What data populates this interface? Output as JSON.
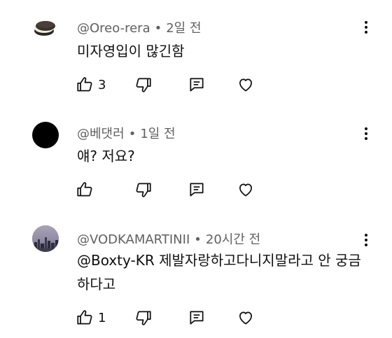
{
  "comments": [
    {
      "author": "@Oreo-rera",
      "time": "2일 전",
      "text": "미자영입이 많긴함",
      "likes": "3",
      "avatar": "oreo-cookie-avatar"
    },
    {
      "author": "@베댓러",
      "time": "1일 전",
      "text": "얘? 저요?",
      "likes": "",
      "avatar": "black-circle-avatar"
    },
    {
      "author": "@VODKAMARTINII",
      "time": "20시간 전",
      "text": "@Boxty-KR 제발자랑하고다니지말라고 안 궁금하다고",
      "likes": "1",
      "avatar": "city-skyline-avatar"
    }
  ],
  "separator": "•",
  "icons": {
    "like": "thumbs-up-icon",
    "dislike": "thumbs-down-icon",
    "reply": "comment-icon",
    "heart": "heart-icon",
    "menu": "more-vert-icon"
  },
  "colors": {
    "text": "#0f0f0f",
    "meta": "#606060"
  }
}
